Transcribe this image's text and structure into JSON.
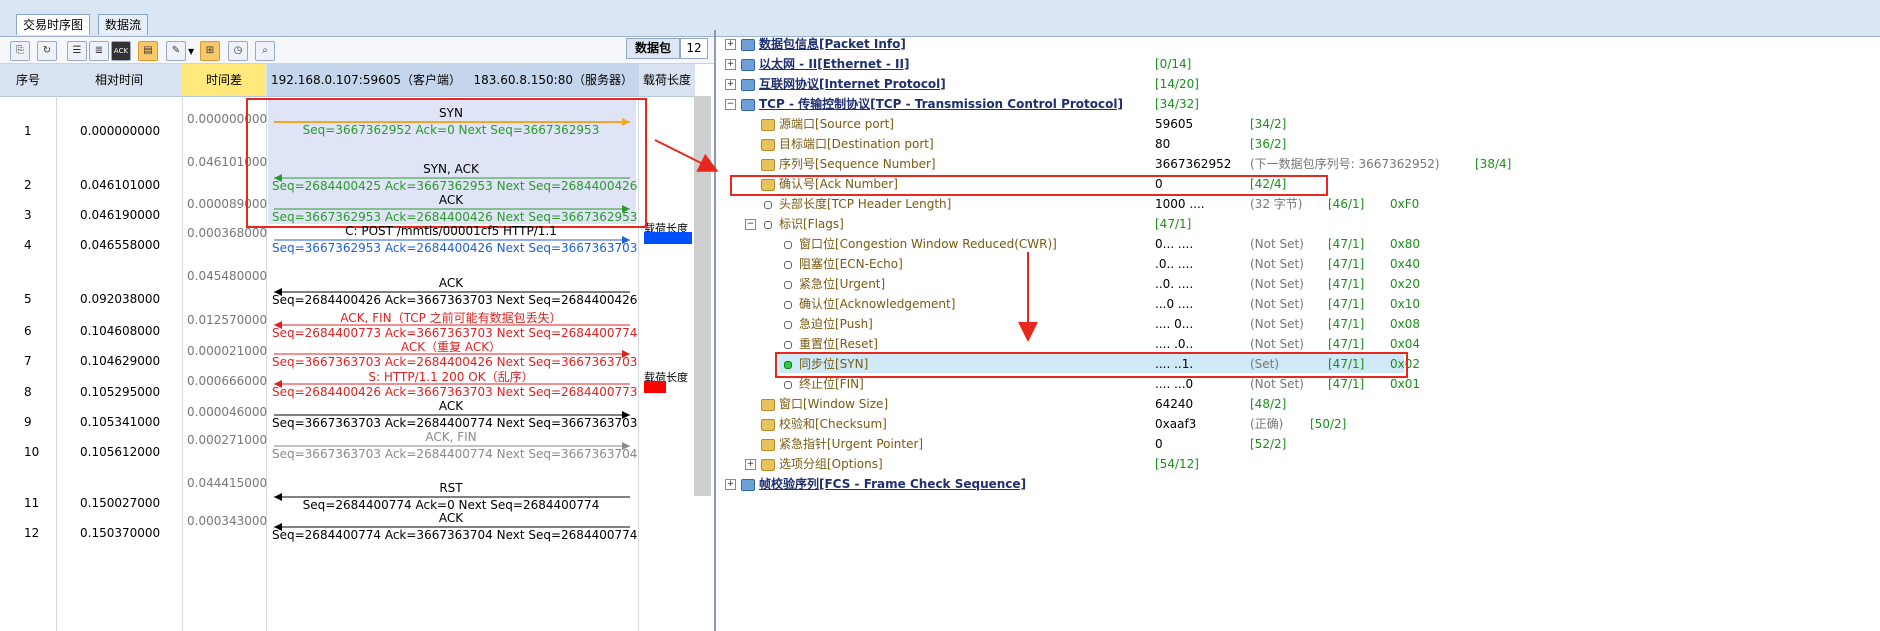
{
  "tabs": [
    {
      "label": "交易时序图",
      "active": true
    },
    {
      "label": "数据流",
      "active": false
    }
  ],
  "toolbar": {
    "buttons": [
      "copy-icon",
      "refresh-icon",
      "list-icon",
      "list-alt-icon",
      "ack-icon",
      "highlight-icon",
      "marker-icon",
      "layout-icon",
      "clock-icon",
      "search-icon"
    ],
    "ack_text": "ACK",
    "packets_label": "数据包",
    "packets_count": "12"
  },
  "ladder": {
    "headers": {
      "no": "序号",
      "rel_time": "相对时间",
      "delta": "时间差",
      "client": "192.168.0.107:59605（客户端）",
      "server": "183.60.8.150:80（服务器）",
      "payload": "载荷长度"
    },
    "rows": [
      {
        "no": "1",
        "time": "0.000000000"
      },
      {
        "no": "2",
        "time": "0.046101000"
      },
      {
        "no": "3",
        "time": "0.046190000"
      },
      {
        "no": "4",
        "time": "0.046558000"
      },
      {
        "no": "5",
        "time": "0.092038000"
      },
      {
        "no": "6",
        "time": "0.104608000"
      },
      {
        "no": "7",
        "time": "0.104629000"
      },
      {
        "no": "8",
        "time": "0.105295000"
      },
      {
        "no": "9",
        "time": "0.105341000"
      },
      {
        "no": "10",
        "time": "0.105612000"
      },
      {
        "no": "11",
        "time": "0.150027000"
      },
      {
        "no": "12",
        "time": "0.150370000"
      }
    ],
    "deltas": [
      "0.000000000",
      "0.046101000",
      "0.000089000",
      "0.000368000",
      "0.045480000",
      "0.012570000",
      "0.000021000",
      "0.000666000",
      "0.000046000",
      "0.000271000",
      "0.044415000",
      "0.000343000"
    ],
    "messages": [
      {
        "label": "SYN",
        "seq": "Seq=3667362952  Ack=0  Next Seq=3667362953",
        "color": "#2a9a2a",
        "arrow_color": "#f5a623",
        "dir": "right"
      },
      {
        "label": "SYN, ACK",
        "seq": "Seq=2684400425  Ack=3667362953  Next Seq=2684400426",
        "color": "#2a9a2a",
        "arrow_color": "#2a9a2a",
        "dir": "left"
      },
      {
        "label": "ACK",
        "seq": "Seq=3667362953  Ack=2684400426  Next Seq=3667362953",
        "color": "#2a9a2a",
        "arrow_color": "#2a9a2a",
        "dir": "right"
      },
      {
        "label": "C: POST /mmtls/00001cf5 HTTP/1.1",
        "seq": "Seq=3667362953  Ack=2684400426  Next Seq=3667363703",
        "color": "#1f5fd6",
        "arrow_color": "#1f5fd6",
        "dir": "right"
      },
      {
        "label": "ACK",
        "seq": "Seq=2684400426  Ack=3667363703  Next Seq=2684400426",
        "color": "#000000",
        "arrow_color": "#000000",
        "dir": "left"
      },
      {
        "label": "ACK, FIN（TCP 之前可能有数据包丢失）",
        "seq": "Seq=2684400773  Ack=3667363703  Next Seq=2684400774",
        "color": "#e02020",
        "arrow_color": "#e02020",
        "dir": "left"
      },
      {
        "label": "ACK（重复 ACK）",
        "seq": "Seq=3667363703  Ack=2684400426  Next Seq=3667363703",
        "color": "#e02020",
        "arrow_color": "#e02020",
        "dir": "right"
      },
      {
        "label": "S: HTTP/1.1 200 OK（乱序）",
        "seq": "Seq=2684400426  Ack=3667363703  Next Seq=2684400773",
        "color": "#e02020",
        "arrow_color": "#e02020",
        "dir": "left"
      },
      {
        "label": "ACK",
        "seq": "Seq=3667363703  Ack=2684400774  Next Seq=3667363703",
        "color": "#000000",
        "arrow_color": "#000000",
        "dir": "right"
      },
      {
        "label": "ACK, FIN",
        "seq": "Seq=3667363703  Ack=2684400774  Next Seq=3667363704",
        "color": "#8a8a8a",
        "arrow_color": "#8a8a8a",
        "dir": "right"
      },
      {
        "label": "RST",
        "seq": "Seq=2684400774  Ack=0  Next Seq=2684400774",
        "color": "#000000",
        "arrow_color": "#000000",
        "dir": "left"
      },
      {
        "label": "ACK",
        "seq": "Seq=2684400774  Ack=3667363704  Next Seq=2684400774",
        "color": "#000000",
        "arrow_color": "#000000",
        "dir": "left"
      }
    ],
    "payload_labels": [
      "载荷长度",
      "载荷长度"
    ],
    "payload_colors": [
      "#0050ff",
      "#ff0000"
    ]
  },
  "tree": [
    {
      "key": "pkt",
      "name": "数据包信息[Packet Info]"
    },
    {
      "key": "eth",
      "name": "以太网 - II[Ethernet - II]",
      "range": "[0/14]"
    },
    {
      "key": "ip",
      "name": "互联网协议[Internet Protocol]",
      "range": "[14/20]"
    },
    {
      "key": "tcp",
      "name": "TCP - 传输控制协议[TCP - Transmission Control Protocol]",
      "range": "[34/32]"
    },
    {
      "key": "sport",
      "name": "源端口[Source port]",
      "value": "59605",
      "range": "[34/2]"
    },
    {
      "key": "dport",
      "name": "目标端口[Destination port]",
      "value": "80",
      "range": "[36/2]"
    },
    {
      "key": "seqn",
      "name": "序列号[Sequence Number]",
      "value": "3667362952",
      "note": "(下一数据包序列号: 3667362952)",
      "range": "[38/4]"
    },
    {
      "key": "ackn",
      "name": "确认号[Ack Number]",
      "value": "0",
      "range": "[42/4]"
    },
    {
      "key": "hlen",
      "name": "头部长度[TCP Header Length]",
      "value": "1000 ....",
      "note": "(32 字节)",
      "range": "[46/1]",
      "hex": "0xF0"
    },
    {
      "key": "flags",
      "name": "标识[Flags]",
      "range": "[47/1]"
    },
    {
      "key": "cwr",
      "name": "窗口位[Congestion Window Reduced(CWR)]",
      "value": "0... ....",
      "note": "(Not Set)",
      "range": "[47/1]",
      "hex": "0x80"
    },
    {
      "key": "ece",
      "name": "阻塞位[ECN-Echo]",
      "value": ".0.. ....",
      "note": "(Not Set)",
      "range": "[47/1]",
      "hex": "0x40"
    },
    {
      "key": "urg",
      "name": "紧急位[Urgent]",
      "value": "..0. ....",
      "note": "(Not Set)",
      "range": "[47/1]",
      "hex": "0x20"
    },
    {
      "key": "ackf",
      "name": "确认位[Acknowledgement]",
      "value": "...0 ....",
      "note": "(Not Set)",
      "range": "[47/1]",
      "hex": "0x10"
    },
    {
      "key": "psh",
      "name": "急迫位[Push]",
      "value": ".... 0...",
      "note": "(Not Set)",
      "range": "[47/1]",
      "hex": "0x08"
    },
    {
      "key": "rst",
      "name": "重置位[Reset]",
      "value": ".... .0..",
      "note": "(Not Set)",
      "range": "[47/1]",
      "hex": "0x04"
    },
    {
      "key": "syn",
      "name": "同步位[SYN]",
      "value": ".... ..1.",
      "note": "(Set)",
      "range": "[47/1]",
      "hex": "0x02"
    },
    {
      "key": "fin",
      "name": "终止位[FIN]",
      "value": ".... ...0",
      "note": "(Not Set)",
      "range": "[47/1]",
      "hex": "0x01"
    },
    {
      "key": "win",
      "name": "窗口[Window Size]",
      "value": "64240",
      "range": "[48/2]"
    },
    {
      "key": "csum",
      "name": "校验和[Checksum]",
      "value": "0xaaf3",
      "note": "(正确)",
      "range": "[50/2]"
    },
    {
      "key": "urgp",
      "name": "紧急指针[Urgent Pointer]",
      "value": "0",
      "range": "[52/2]"
    },
    {
      "key": "opts",
      "name": "选项分组[Options]",
      "range": "[54/12]"
    },
    {
      "key": "fcs",
      "name": "帧校验序列[FCS - Frame Check Sequence]"
    }
  ]
}
